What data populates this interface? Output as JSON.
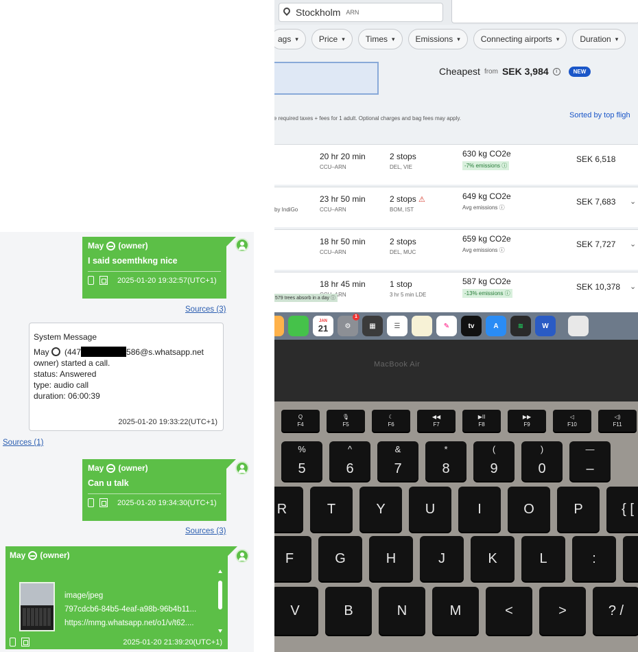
{
  "chat": {
    "messages": [
      {
        "sender": "May",
        "role": "(owner)",
        "text": "I said soemthkng nice",
        "timestamp": "2025-01-20 19:32:57(UTC+1)",
        "sources": "Sources (3)"
      },
      {
        "sender": "May",
        "role": "(owner)",
        "text": "Can u talk",
        "timestamp": "2025-01-20 19:34:30(UTC+1)",
        "sources": "Sources (3)"
      }
    ],
    "system_message": {
      "title": "System Message",
      "line1_pre": "May",
      "line1_num_start": "(447",
      "line1_num_end": "586@s.whatsapp.net",
      "line2": "owner) started a call.",
      "status": "status: Answered",
      "type": "type: audio call",
      "duration": "duration: 06:00:39",
      "timestamp": "2025-01-20 19:33:22(UTC+1)",
      "sources": "Sources (1)"
    },
    "attachment": {
      "sender": "May",
      "role": "(owner)",
      "mime": "image/jpeg",
      "hash": "797cdcb6-84b5-4eaf-a98b-96b4b11...",
      "url": "https://mmg.whatsapp.net/o1/v/t62....",
      "timestamp": "2025-01-20 21:39:20(UTC+1)"
    }
  },
  "photo": {
    "location": "Stockholm",
    "location_code": "ARN",
    "filters": [
      {
        "label": "ags"
      },
      {
        "label": "Price"
      },
      {
        "label": "Times"
      },
      {
        "label": "Emissions"
      },
      {
        "label": "Connecting airports"
      },
      {
        "label": "Duration"
      }
    ],
    "cheapest_label": "Cheapest",
    "cheapest_from": "from",
    "cheapest_price": "SEK 3,984",
    "new_badge": "NEW",
    "notice": "ude required taxes + fees for 1 adult. Optional charges and bag fees may apply.",
    "sorted": "Sorted by top fligh",
    "flights": [
      {
        "airline": "",
        "duration": "20 hr 20 min",
        "route": "CCU–ARN",
        "stops": "2 stops",
        "warn": "",
        "via": "DEL, VIE",
        "emissions": "630 kg CO2e",
        "emission_note": "-7% emissions ⓘ",
        "good": true,
        "fare": "SEK 6,518"
      },
      {
        "airline": "by IndiGo",
        "duration": "23 hr 50 min",
        "route": "CCU–ARN",
        "stops": "2 stops",
        "warn": "⚠",
        "via": "BOM, IST",
        "emissions": "649 kg CO2e",
        "emission_note": "Avg emissions ⓘ",
        "good": false,
        "fare": "SEK 7,683"
      },
      {
        "airline": "",
        "duration": "18 hr 50 min",
        "route": "CCU–ARN",
        "stops": "2 stops",
        "warn": "",
        "via": "DEL, MUC",
        "emissions": "659 kg CO2e",
        "emission_note": "Avg emissions ⓘ",
        "good": false,
        "fare": "SEK 7,727"
      },
      {
        "airline": "",
        "duration": "18 hr 45 min",
        "route": "CCU–ARN",
        "stops": "1 stop",
        "warn": "",
        "via": "3 hr 5 min LDE",
        "emissions": "587 kg CO2e",
        "emission_note": "-13% emissions ⓘ",
        "good": true,
        "fare": "SEK 10,378"
      }
    ],
    "footnote": "579 trees absorb in a day ⓘ",
    "dock_calendar_day": "21",
    "dock_calendar_month": "JAN",
    "dock_badge": "1",
    "dock_tv": "tv",
    "dock_word": "W",
    "brand": "MacBook Air",
    "fkeys": [
      {
        "glyph": "Q",
        "label": "F4"
      },
      {
        "glyph": "🎙",
        "label": "F5"
      },
      {
        "glyph": "☾",
        "label": "F6"
      },
      {
        "glyph": "◀◀",
        "label": "F7"
      },
      {
        "glyph": "▶II",
        "label": "F8"
      },
      {
        "glyph": "▶▶",
        "label": "F9"
      },
      {
        "glyph": "◁",
        "label": "F10"
      },
      {
        "glyph": "◁)",
        "label": "F11"
      }
    ],
    "number_keys": [
      {
        "top": "%",
        "bot": "5"
      },
      {
        "top": "^",
        "bot": "6"
      },
      {
        "top": "&",
        "bot": "7"
      },
      {
        "top": "*",
        "bot": "8"
      },
      {
        "top": "(",
        "bot": "9"
      },
      {
        "top": ")",
        "bot": "0"
      },
      {
        "top": "—",
        "bot": "–"
      }
    ],
    "row_q": [
      "R",
      "T",
      "Y",
      "U",
      "I",
      "O",
      "P",
      "{ ["
    ],
    "row_a": [
      "F",
      "G",
      "H",
      "J",
      "K",
      "L",
      ":",
      ""
    ],
    "row_z": [
      "V",
      "B",
      "N",
      "M",
      "<",
      ">",
      "? /"
    ]
  }
}
